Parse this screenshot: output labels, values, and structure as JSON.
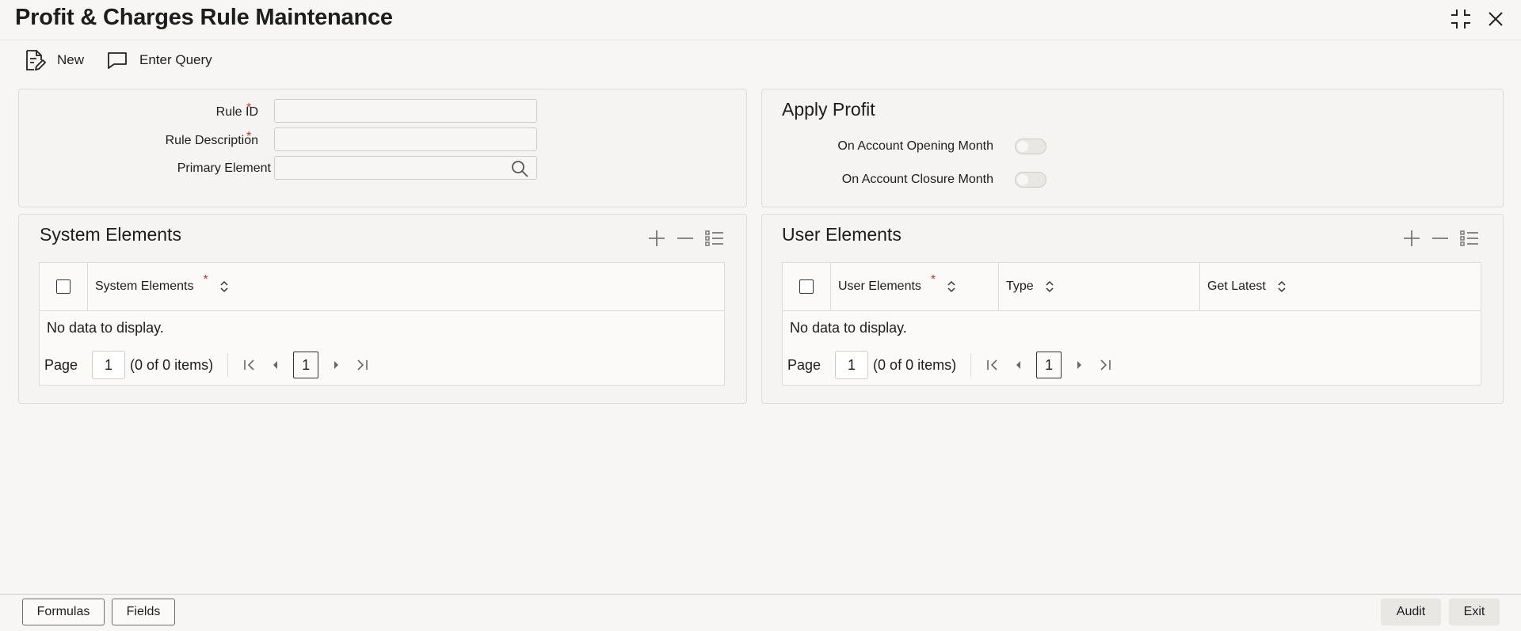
{
  "window": {
    "title": "Profit & Charges Rule Maintenance"
  },
  "toolbar": {
    "new_label": "New",
    "enter_query_label": "Enter Query"
  },
  "rule_form": {
    "rule_id_label": "Rule ID",
    "rule_description_label": "Rule Description",
    "primary_element_label": "Primary Element",
    "required_marker": "*",
    "rule_id_value": "",
    "rule_description_value": "",
    "primary_element_value": ""
  },
  "apply_profit": {
    "title": "Apply Profit",
    "opening_month_label": "On Account Opening Month",
    "closure_month_label": "On Account Closure Month",
    "opening_month_on": false,
    "closure_month_on": false
  },
  "system_elements": {
    "title": "System Elements",
    "columns": [
      "System Elements"
    ],
    "no_data": "No data to display.",
    "pager": {
      "page_label": "Page",
      "page_value": "1",
      "items_text": "(0 of 0 items)",
      "current": "1"
    }
  },
  "user_elements": {
    "title": "User Elements",
    "columns": [
      "User Elements",
      "Type",
      "Get Latest"
    ],
    "no_data": "No data to display.",
    "pager": {
      "page_label": "Page",
      "page_value": "1",
      "items_text": "(0 of 0 items)",
      "current": "1"
    }
  },
  "footer": {
    "formulas_label": "Formulas",
    "fields_label": "Fields",
    "audit_label": "Audit",
    "exit_label": "Exit"
  },
  "colors": {
    "required": "#c0392b",
    "background": "#f7f6f4",
    "panel": "#f5f4f2"
  }
}
